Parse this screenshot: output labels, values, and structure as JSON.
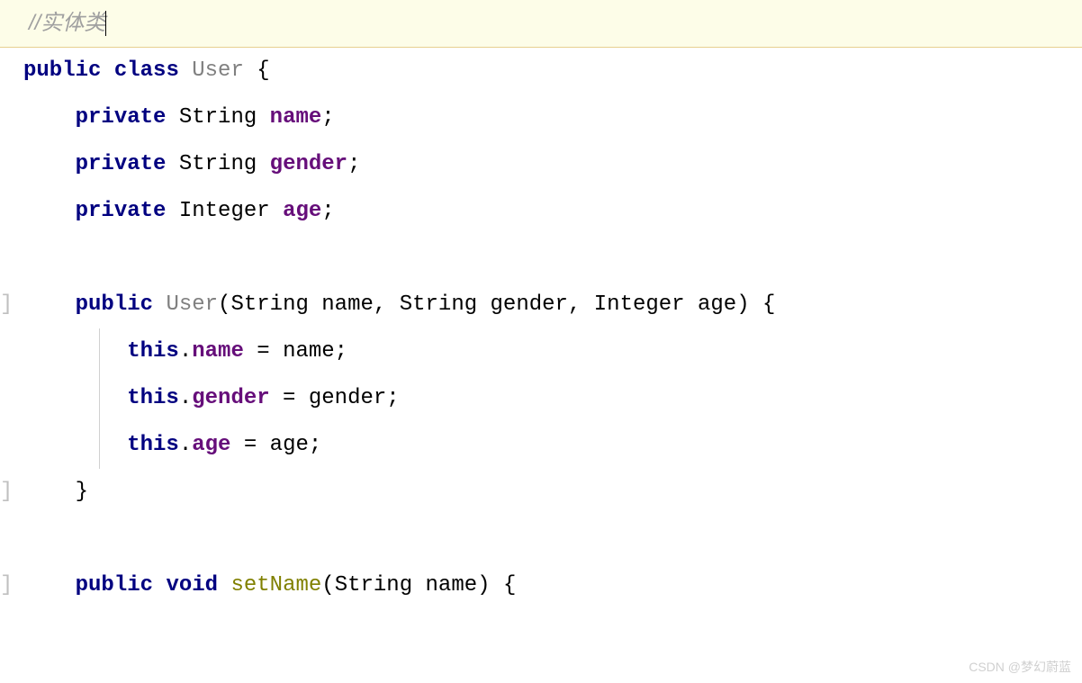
{
  "code": {
    "comment": "//实体类",
    "kw_public": "public",
    "kw_class": "class",
    "kw_private": "private",
    "kw_void": "void",
    "kw_this": "this",
    "classname_user": "User",
    "type_string": "String",
    "type_integer": "Integer",
    "field_name": "name",
    "field_gender": "gender",
    "field_age": "age",
    "method_setname": "setName",
    "param_name": "name",
    "param_gender": "gender",
    "param_age": "age",
    "brace_open": "{",
    "brace_close": "}",
    "paren_open": "(",
    "paren_close": ")",
    "semicolon": ";",
    "comma": ",",
    "dot": ".",
    "equals": " = ",
    "space": " ",
    "gutter_mark": "]"
  },
  "watermark": "CSDN @梦幻蔚蓝"
}
